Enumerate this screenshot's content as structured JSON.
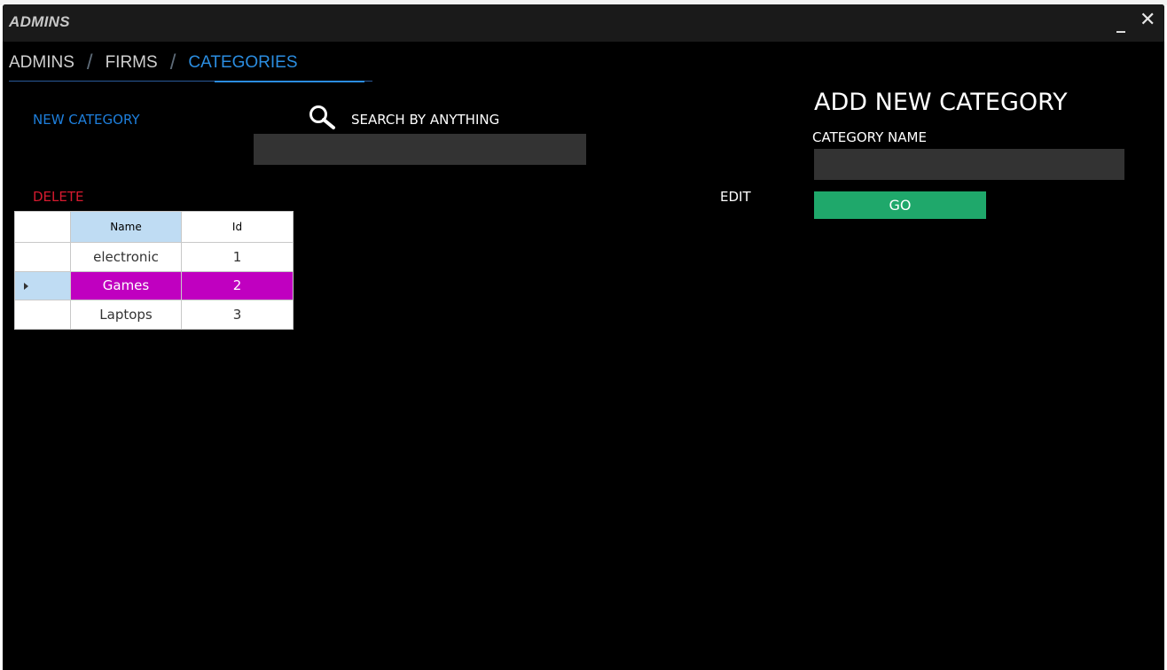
{
  "window": {
    "title": "ADMINS",
    "minimize_label": "_",
    "close_label": "✕"
  },
  "tabs": [
    {
      "label": "ADMINS",
      "active": false
    },
    {
      "label": "FIRMS",
      "active": false
    },
    {
      "label": "CATEGORIES",
      "active": true
    }
  ],
  "tab_separator": "/",
  "actions": {
    "new_category": "NEW CATEGORY",
    "delete": "DELETE",
    "edit": "EDIT"
  },
  "search": {
    "label": "SEARCH BY ANYTHING",
    "value": "",
    "icon": "search-icon"
  },
  "grid": {
    "columns": [
      "Name",
      "Id"
    ],
    "rows": [
      {
        "name": "electronic",
        "id": "1",
        "selected": false
      },
      {
        "name": "Games",
        "id": "2",
        "selected": true
      },
      {
        "name": "Laptops",
        "id": "3",
        "selected": false
      }
    ],
    "selection_color": "#c000c0",
    "header_highlight": "#bfdcf3"
  },
  "add_form": {
    "title": "ADD NEW CATEGORY",
    "field_label": "CATEGORY NAME",
    "field_value": "",
    "submit_label": "GO",
    "submit_color": "#1fa86b"
  },
  "colors": {
    "background": "#000000",
    "accent_blue": "#2b8de0",
    "danger_red": "#d61a2f"
  }
}
